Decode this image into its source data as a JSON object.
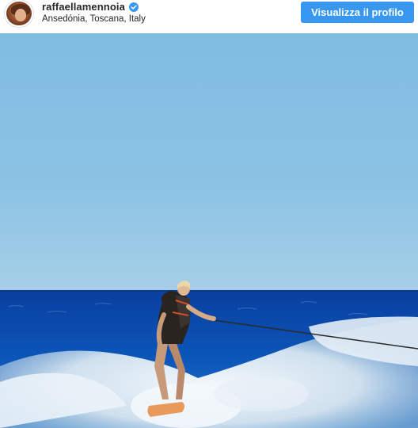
{
  "post_header": {
    "username": "raffaellamennoia",
    "verified_icon": "verified-badge-icon",
    "location": "Ansedónia, Toscana, Italy",
    "profile_button_label": "Visualizza il profilo"
  },
  "colors": {
    "button_bg": "#3897f0",
    "verified_badge": "#3897f0",
    "sky": "#86bde0",
    "sea": "#0b4db0",
    "foam": "#dfeaf2"
  }
}
